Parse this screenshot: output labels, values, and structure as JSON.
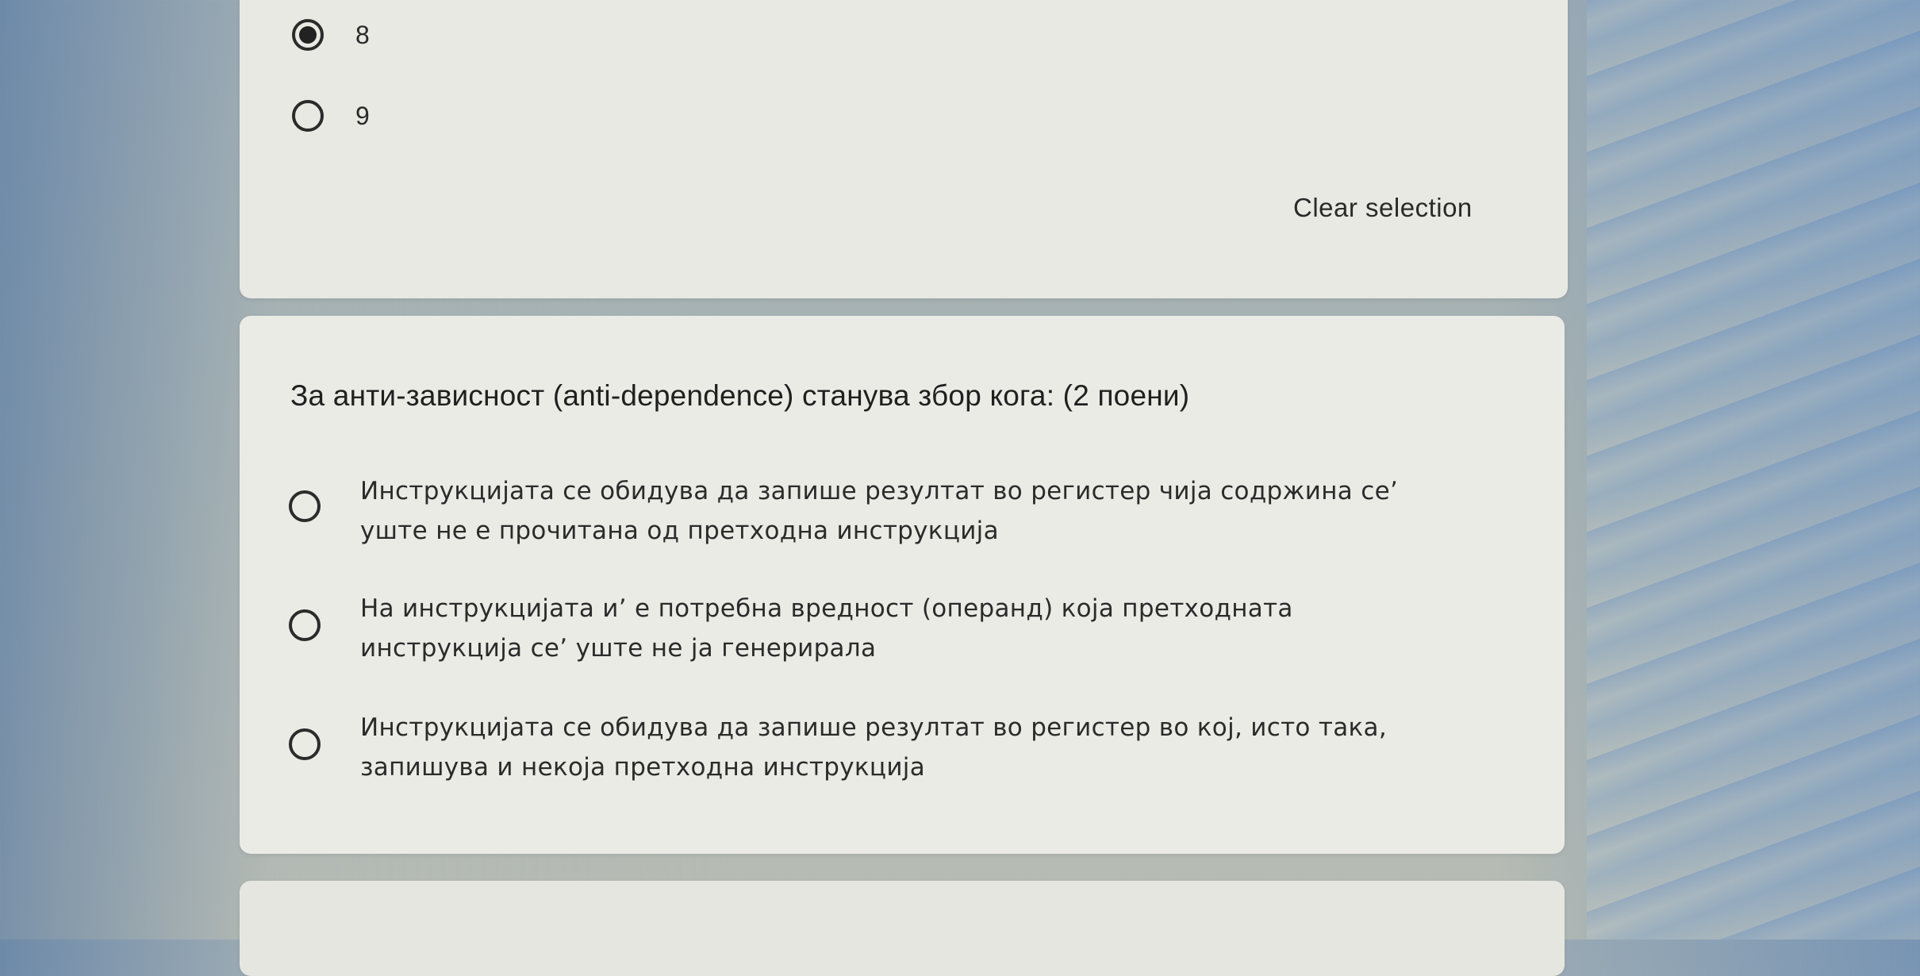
{
  "previous_question": {
    "options": [
      {
        "label": "8",
        "selected": true
      },
      {
        "label": "9",
        "selected": false
      }
    ],
    "clear_selection_label": "Clear selection"
  },
  "question": {
    "title": "За анти-зависност (anti-dependence) станува збор кога: (2 поени)",
    "options": [
      {
        "text": "Инструкцијата се обидува да запише резултат во регистер чија содржина се’ уште не е прочитана од претходна инструкција",
        "selected": false
      },
      {
        "text": "На инструкцијата и’ е потребна вредност (операнд) која претходната инструкција се’ уште не ја генерирала",
        "selected": false
      },
      {
        "text": "Инструкцијата се обидува да запише резултат во регистер во кој, исто така, запишува и некоја претходна инструкција",
        "selected": false
      }
    ]
  }
}
